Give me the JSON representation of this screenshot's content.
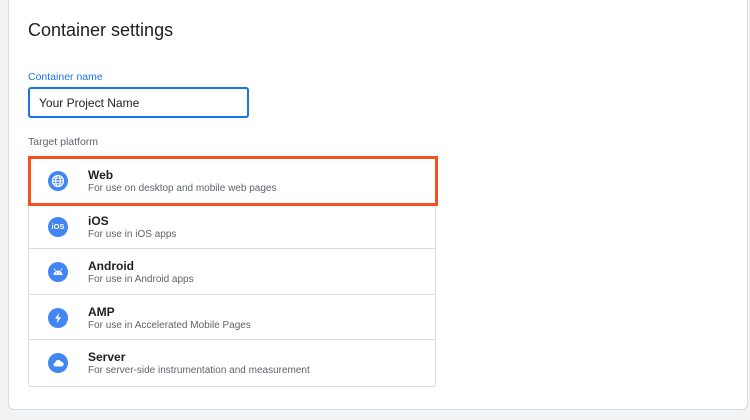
{
  "title": "Container settings",
  "container_name": {
    "label": "Container name",
    "value": "Your Project Name"
  },
  "target_platform": {
    "label": "Target platform",
    "options": [
      {
        "name": "Web",
        "description": "For use on desktop and mobile web pages",
        "icon": "globe-icon"
      },
      {
        "name": "iOS",
        "description": "For use in iOS apps",
        "icon": "ios-icon",
        "icon_text": "iOS"
      },
      {
        "name": "Android",
        "description": "For use in Android apps",
        "icon": "android-icon"
      },
      {
        "name": "AMP",
        "description": "For use in Accelerated Mobile Pages",
        "icon": "lightning-icon"
      },
      {
        "name": "Server",
        "description": "For server-side instrumentation and measurement",
        "icon": "cloud-icon"
      }
    ],
    "highlighted": "Web"
  },
  "colors": {
    "accent": "#1a73e8",
    "icon_bg": "#4285f4",
    "highlight": "#f4511e"
  }
}
